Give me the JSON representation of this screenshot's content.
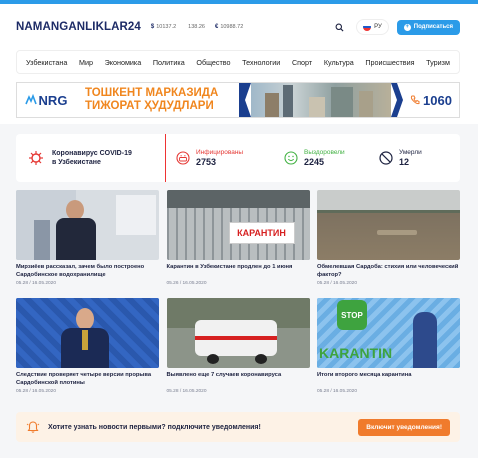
{
  "site": {
    "name": "NAMANGANLIKLAR24"
  },
  "rates": [
    {
      "symbol": "$",
      "value": "10137.2"
    },
    {
      "symbol": "",
      "value": "138.26"
    },
    {
      "symbol": "€",
      "value": "10988.72"
    }
  ],
  "header": {
    "lang": "РУ",
    "subscribe": "Подписаться"
  },
  "nav": [
    "Узбекистана",
    "Мир",
    "Экономика",
    "Политика",
    "Общество",
    "Технологии",
    "Спорт",
    "Культура",
    "Происшествия",
    "Туризм"
  ],
  "banner": {
    "brand": "NRG",
    "line1": "ТОШКЕНТ МАРКАЗИДА",
    "line2": "ТИЖОРАТ ҲУДУДЛАРИ",
    "phone": "1060"
  },
  "covid": {
    "title_line1": "Коронавирус COVID-19",
    "title_line2": "в Узбекистане",
    "infected_label": "Инфицированы",
    "infected": "2753",
    "recovered_label": "Выздоровели",
    "recovered": "2245",
    "died_label": "Умерли",
    "died": "12"
  },
  "articles": [
    {
      "title": "Мирзиёев рассказал, зачем было построено Сардобинское водохранилище",
      "meta": "05.28 / 16.05.2020"
    },
    {
      "title": "Карантин в Узбекистане продлен до 1 июня",
      "meta": "05.26 / 16.05.2020"
    },
    {
      "title": "Обмелевшая Сардоба: стихия или человеческий фактор?",
      "meta": "05.28 / 16.05.2020"
    },
    {
      "title": "Следствие проверяет четыре версии прорыва Сардобинской плотины",
      "meta": "05.28 / 16.05.2020"
    },
    {
      "title": "Выявлено еще 7 случаев коронавируса",
      "meta": "05.28 / 16.05.2020"
    },
    {
      "title": "Итоги второго месяца карантина",
      "meta": "05.28 / 16.05.2020"
    }
  ],
  "photo_text": {
    "quarantine": "КАРАНТИН",
    "karantin": "KARANTIN",
    "stop": "STOP"
  },
  "notify": {
    "text": "Хотите узнать новости первыми? подключите уведомления!",
    "button": "Включит  уведомления!"
  },
  "colors": {
    "accent": "#2b9be8",
    "orange": "#f07b2c",
    "red": "#e53935",
    "green": "#43b244",
    "navy": "#1d2b66"
  }
}
